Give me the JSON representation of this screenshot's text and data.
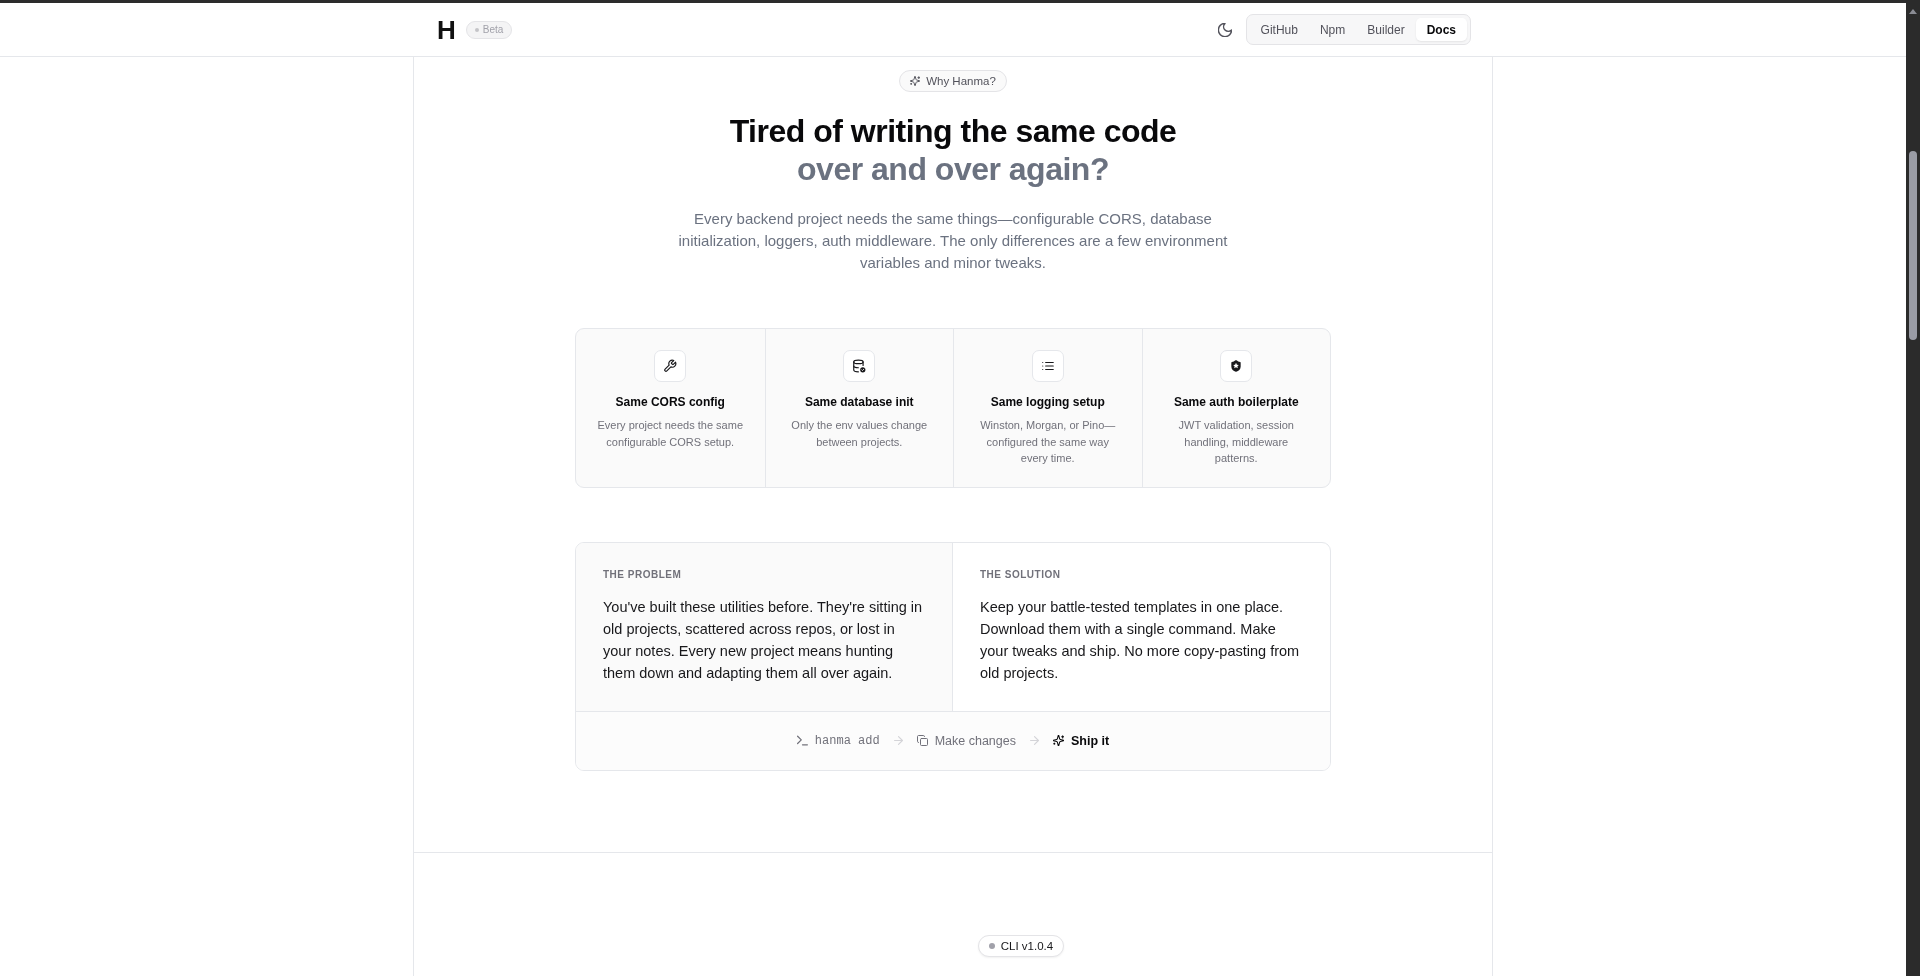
{
  "header": {
    "logo": "H",
    "badge": "Beta",
    "nav": [
      {
        "label": "GitHub",
        "selected": false
      },
      {
        "label": "Npm",
        "selected": false
      },
      {
        "label": "Builder",
        "selected": false
      },
      {
        "label": "Docs",
        "selected": true
      }
    ]
  },
  "hero": {
    "eyebrow": "Why Hanma?",
    "title": "Tired of writing the same code",
    "subtitle": "over and over again?",
    "description": "Every backend project needs the same things—configurable CORS, database initialization, loggers, auth middleware. The only differences are a few environment variables and minor tweaks."
  },
  "features": [
    {
      "title": "Same CORS config",
      "description": "Every project needs the same configurable CORS setup."
    },
    {
      "title": "Same database init",
      "description": "Only the env values change between projects."
    },
    {
      "title": "Same logging setup",
      "description": "Winston, Morgan, or Pino—configured the same way every time."
    },
    {
      "title": "Same auth boilerplate",
      "description": "JWT validation, session handling, middleware patterns."
    }
  ],
  "comparison": {
    "columns": [
      {
        "label": "THE PROBLEM",
        "text": "You've built these utilities before. They're sitting in old projects, scattered across repos, or lost in your notes. Every new project means hunting them down and adapting them all over again."
      },
      {
        "label": "THE SOLUTION",
        "text": "Keep your battle-tested templates in one place. Download them with a single command. Make your tweaks and ship. No more copy-pasting from old projects."
      }
    ],
    "steps": [
      {
        "kind": "command",
        "label": "hanma add",
        "active": false
      },
      {
        "kind": "text",
        "label": "Make changes",
        "active": false
      },
      {
        "kind": "text",
        "label": "Ship it",
        "active": true
      }
    ]
  },
  "cli_badge": {
    "label": "CLI v1.0.4"
  }
}
